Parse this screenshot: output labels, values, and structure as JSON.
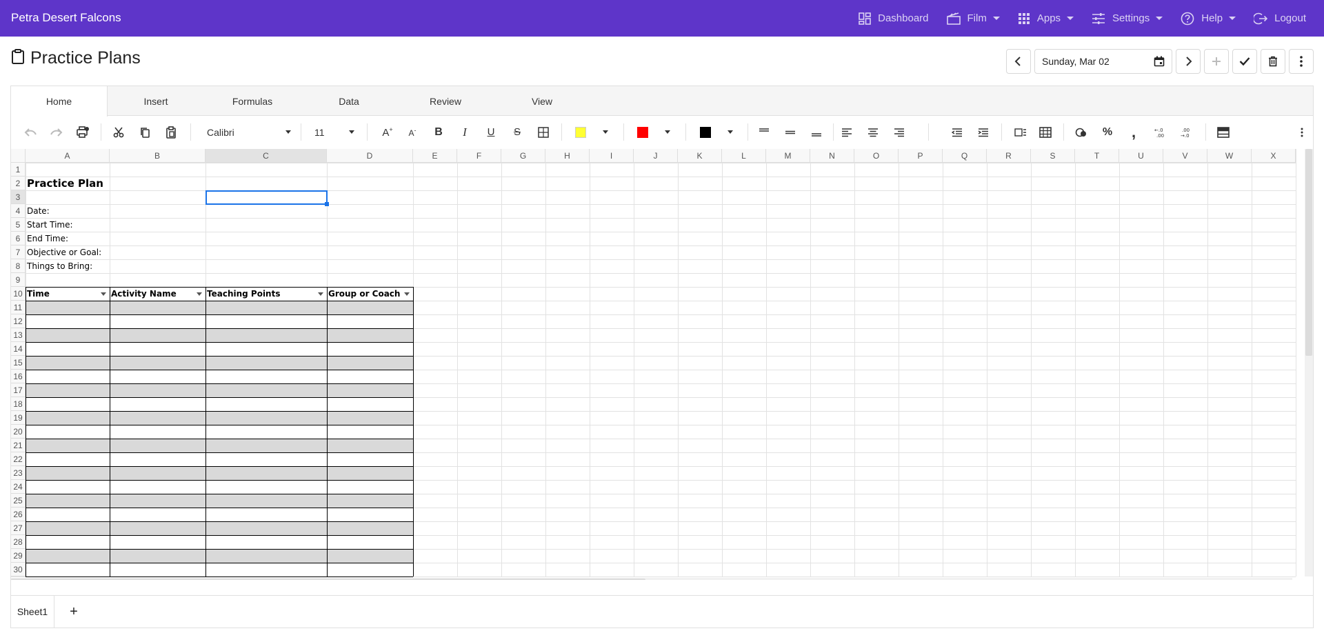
{
  "app": {
    "brand": "Petra Desert Falcons"
  },
  "nav": [
    {
      "label": "Dashboard",
      "icon": "dashboard-icon",
      "has_caret": false
    },
    {
      "label": "Film",
      "icon": "film-icon",
      "has_caret": true
    },
    {
      "label": "Apps",
      "icon": "apps-grid-icon",
      "has_caret": true
    },
    {
      "label": "Settings",
      "icon": "settings-sliders-icon",
      "has_caret": true
    },
    {
      "label": "Help",
      "icon": "help-icon",
      "has_caret": true
    },
    {
      "label": "Logout",
      "icon": "logout-icon",
      "has_caret": false
    }
  ],
  "page": {
    "title": "Practice Plans",
    "title_icon": "clipboard-icon"
  },
  "date_picker": {
    "value": "Sunday, Mar 02",
    "icon": "calendar-icon"
  },
  "ribbon_tabs": [
    "Home",
    "Insert",
    "Formulas",
    "Data",
    "Review",
    "View"
  ],
  "active_tab": "Home",
  "toolbar": {
    "font_name": "Calibri",
    "font_size": "11",
    "fill_color": "#ffff33",
    "font_color": "#ff0000",
    "border_color": "#000000"
  },
  "columns": [
    "A",
    "B",
    "C",
    "D",
    "E",
    "F",
    "G",
    "H",
    "I",
    "J",
    "K",
    "L",
    "M",
    "N",
    "O",
    "P",
    "Q",
    "R",
    "S",
    "T",
    "U",
    "V",
    "W",
    "X"
  ],
  "rows": [
    "1",
    "2",
    "3",
    "4",
    "5",
    "6",
    "7",
    "8",
    "9",
    "10",
    "11",
    "12",
    "13",
    "14",
    "15",
    "16",
    "17",
    "18",
    "19",
    "20",
    "21",
    "22",
    "23",
    "24",
    "25",
    "26",
    "27",
    "28",
    "29",
    "30"
  ],
  "selected_cell": "C3",
  "cells": {
    "title": "Practice Plan",
    "labels": [
      "Date:",
      "Start Time:",
      "End Time:",
      "Objective or Goal:",
      "Things to Bring:"
    ],
    "table_headers": [
      "Time",
      "Activity Name",
      "Teaching Points",
      "Group or Coach"
    ]
  },
  "colors": {
    "header_bar": "#5e35c9",
    "band_fill": "#d9d9d9",
    "selection": "#1a73e8"
  },
  "sheets": [
    "Sheet1"
  ]
}
